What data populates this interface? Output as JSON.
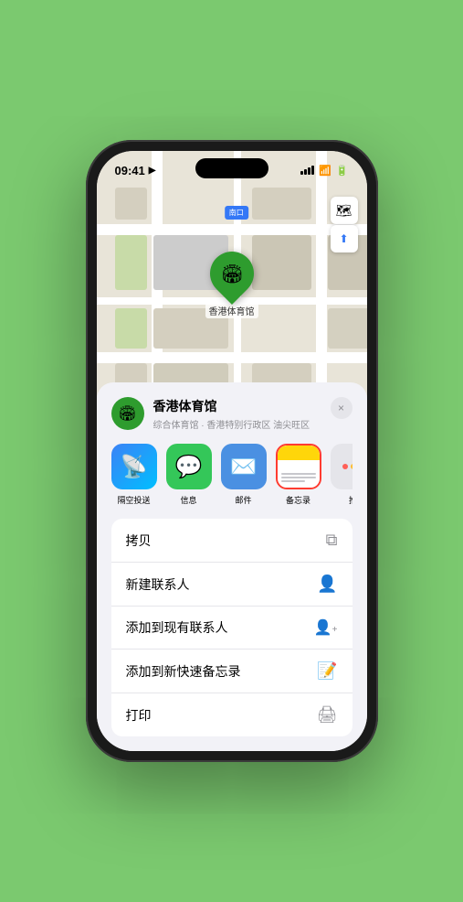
{
  "status_bar": {
    "time": "09:41",
    "location_icon": "▶"
  },
  "map": {
    "label": "南口",
    "pin_label": "香港体育馆",
    "pin_emoji": "🏟"
  },
  "map_controls": {
    "map_btn": "🗺",
    "location_btn": "⬆"
  },
  "bottom_sheet": {
    "place_icon": "🏟",
    "place_name": "香港体育馆",
    "place_desc": "综合体育馆 · 香港特别行政区 油尖旺区",
    "close_label": "×"
  },
  "share_items": [
    {
      "id": "airdrop",
      "label": "隔空投送",
      "type": "airdrop"
    },
    {
      "id": "messages",
      "label": "信息",
      "type": "messages"
    },
    {
      "id": "mail",
      "label": "邮件",
      "type": "mail"
    },
    {
      "id": "notes",
      "label": "备忘录",
      "type": "notes"
    },
    {
      "id": "more",
      "label": "推",
      "type": "more"
    }
  ],
  "action_items": [
    {
      "id": "copy",
      "text": "拷贝",
      "icon": "copy"
    },
    {
      "id": "new-contact",
      "text": "新建联系人",
      "icon": "person"
    },
    {
      "id": "add-contact",
      "text": "添加到现有联系人",
      "icon": "person-add"
    },
    {
      "id": "quick-note",
      "text": "添加到新快速备忘录",
      "icon": "note"
    },
    {
      "id": "print",
      "text": "打印",
      "icon": "print"
    }
  ]
}
